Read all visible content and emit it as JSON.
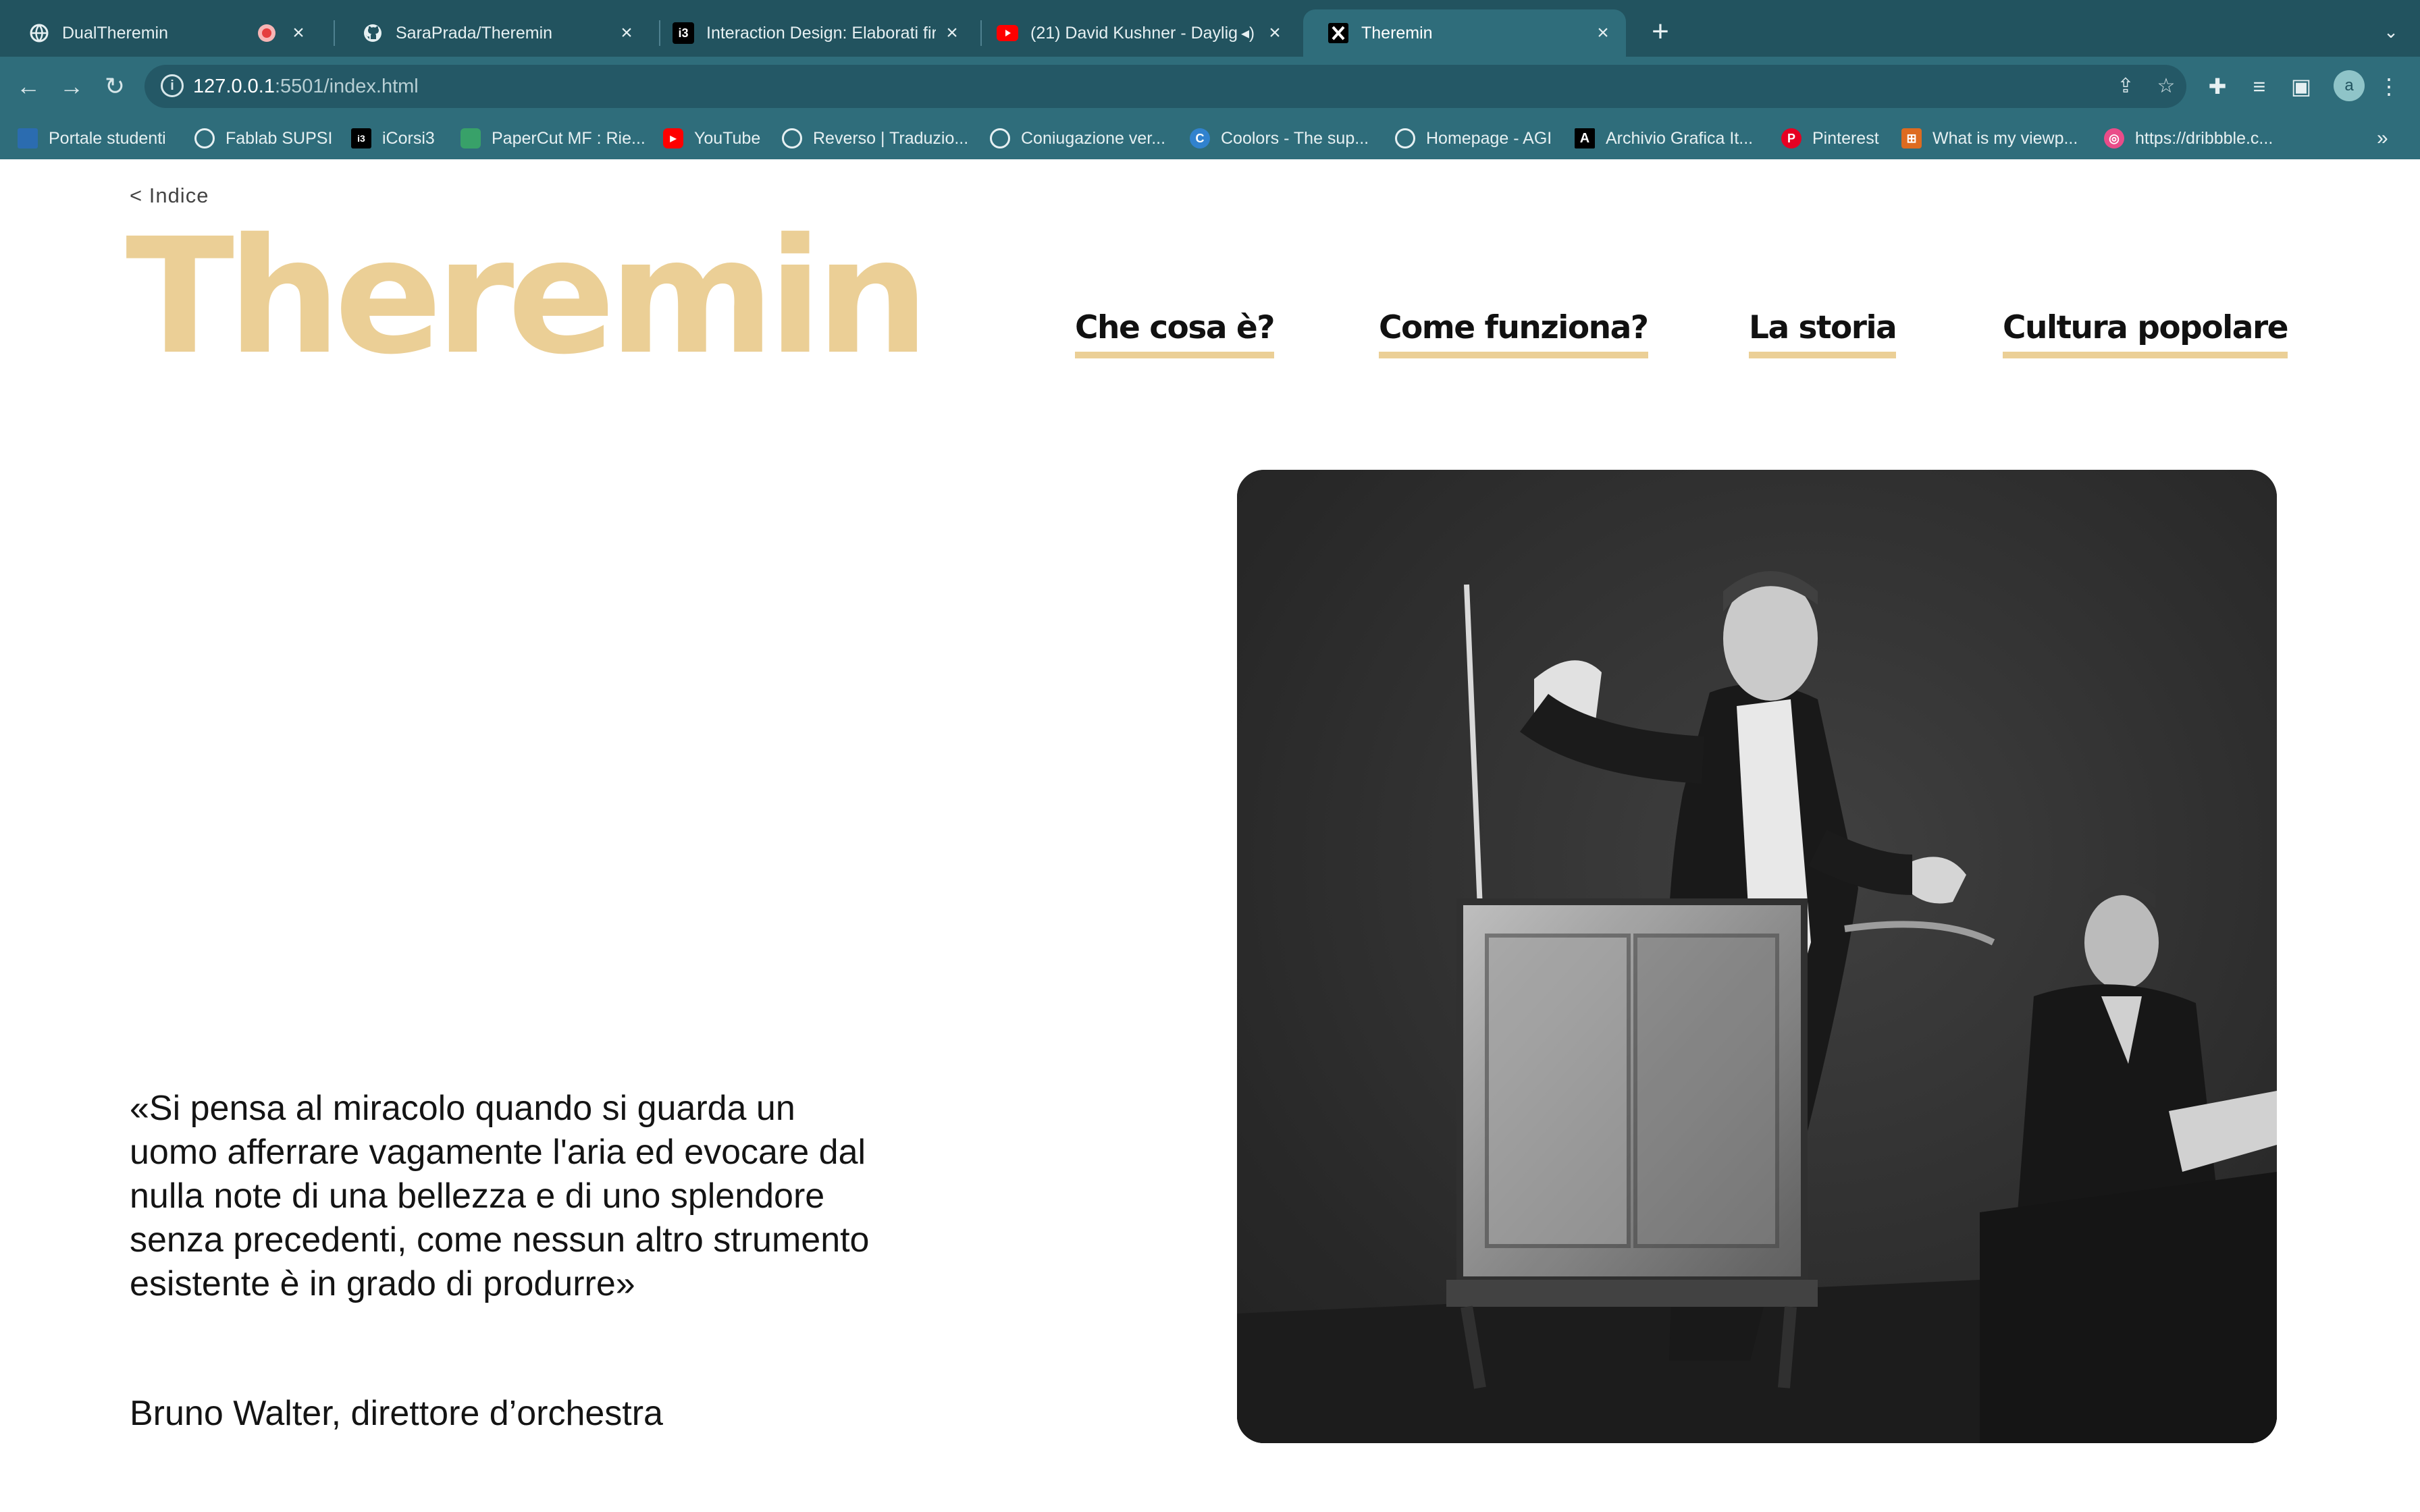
{
  "browser": {
    "tabs": [
      {
        "title": "DualTheremin",
        "icon": "globe-icon"
      },
      {
        "title": "SaraPrada/Theremin",
        "icon": "github-icon"
      },
      {
        "title": "Interaction Design: Elaborati fir",
        "icon": "i3-icon"
      },
      {
        "title": "(21) David Kushner - Daylig",
        "icon": "youtube-icon"
      },
      {
        "title": "Theremin",
        "icon": "x-logo-icon"
      }
    ],
    "url_host": "127.0.0.1",
    "url_path": ":5501/index.html",
    "avatar_letter": "a",
    "bookmarks": [
      {
        "label": "Portale studenti",
        "icon": "portal-icon",
        "color": "#2b6cb0"
      },
      {
        "label": "Fablab SUPSI",
        "icon": "globe-icon",
        "color": "#4a5568"
      },
      {
        "label": "iCorsi3",
        "icon": "i3-icon",
        "color": "#000000"
      },
      {
        "label": "PaperCut MF : Rie...",
        "icon": "papercut-icon",
        "color": "#38a169"
      },
      {
        "label": "YouTube",
        "icon": "youtube-icon",
        "color": "#e53e3e"
      },
      {
        "label": "Reverso | Traduzio...",
        "icon": "reverso-icon",
        "color": "#4a5568"
      },
      {
        "label": "Coniugazione ver...",
        "icon": "reverso-icon",
        "color": "#4a5568"
      },
      {
        "label": "Coolors - The sup...",
        "icon": "coolors-icon",
        "color": "#3182ce"
      },
      {
        "label": "Homepage - AGI",
        "icon": "globe-icon",
        "color": "#4a5568"
      },
      {
        "label": "Archivio Grafica It...",
        "icon": "archive-a-icon",
        "color": "#000000"
      },
      {
        "label": "Pinterest",
        "icon": "pinterest-icon",
        "color": "#e60023"
      },
      {
        "label": "What is my viewp...",
        "icon": "viewport-icon",
        "color": "#dd6b20"
      },
      {
        "label": "https://dribbble.c...",
        "icon": "dribbble-icon",
        "color": "#ea4c89"
      }
    ]
  },
  "page": {
    "back_label": "< Indice",
    "title": "Theremin",
    "nav": [
      {
        "label": "Che cosa è?"
      },
      {
        "label": "Come funziona?"
      },
      {
        "label": "La storia"
      },
      {
        "label": "Cultura popolare"
      }
    ],
    "quote": "«Si pensa al miracolo quando si guarda un uomo afferrare vagamente l'aria ed evocare dal nulla note di una bellezza e di uno splendore senza precedenti, come nessun altro strumento esistente è in grado di produrre»",
    "author": "Bruno Walter, direttore d’orchestra",
    "photo": "historical-photo-theremin-performer",
    "accent_color": "#ebcf96"
  }
}
